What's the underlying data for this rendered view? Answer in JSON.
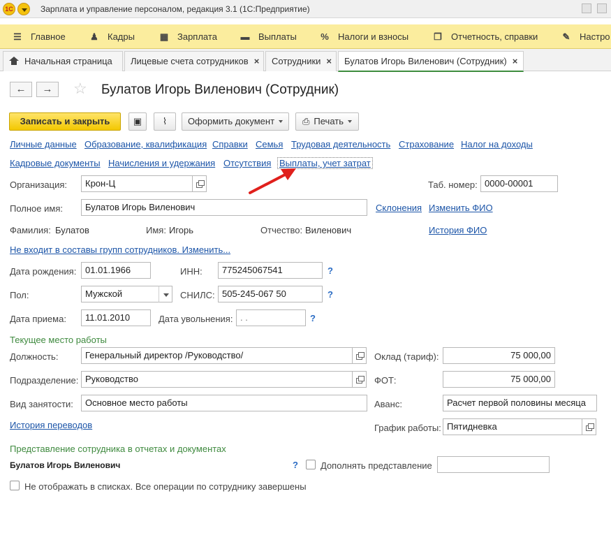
{
  "app": {
    "title": "Зарплата и управление персоналом, редакция 3.1  (1С:Предприятие)",
    "logo_text": "1С"
  },
  "sections": [
    {
      "icon": "☰",
      "label": "Главное"
    },
    {
      "icon": "♟",
      "label": "Кадры"
    },
    {
      "icon": "▦",
      "label": "Зарплата"
    },
    {
      "icon": "▬",
      "label": "Выплаты"
    },
    {
      "icon": "%",
      "label": "Налоги и взносы"
    },
    {
      "icon": "❐",
      "label": "Отчетность, справки"
    },
    {
      "icon": "✎",
      "label": "Настро"
    }
  ],
  "tabs": [
    {
      "label": "Начальная страница"
    },
    {
      "label": "Лицевые счета сотрудников",
      "close": "×"
    },
    {
      "label": "Сотрудники",
      "close": "×"
    },
    {
      "label": "Булатов Игорь Виленович (Сотрудник)",
      "close": "×"
    }
  ],
  "nav": {
    "back": "←",
    "forward": "→",
    "star": "☆"
  },
  "form": {
    "title": "Булатов Игорь Виленович (Сотрудник)"
  },
  "toolbar": {
    "save_close": "Записать и закрыть",
    "save_icon": "▣",
    "attach_icon": "⌇",
    "create_doc": "Оформить документ",
    "print_icon": "⎙",
    "print": "Печать"
  },
  "links_row1": [
    "Личные данные",
    "Образование, квалификация",
    "Справки",
    "Семья",
    "Трудовая деятельность",
    "Страхование",
    "Налог на доходы"
  ],
  "links_row2": [
    "Кадровые документы",
    "Начисления и удержания",
    "Отсутствия",
    "Выплаты, учет затрат"
  ],
  "fields": {
    "org_label": "Организация:",
    "org_value": "Крон-Ц",
    "tab_num_label": "Таб. номер:",
    "tab_num_value": "0000-00001",
    "fullname_label": "Полное имя:",
    "fullname_value": "Булатов Игорь Виленович",
    "declension_link": "Склонения",
    "change_fio_link": "Изменить ФИО",
    "surname_label": "Фамилия:",
    "surname_value": "Булатов",
    "name_label": "Имя:",
    "name_value": "Игорь",
    "patronymic_label": "Отчество:",
    "patronymic_value": "Виленович",
    "history_fio_link": "История ФИО",
    "groups_link": "Не входит в составы групп сотрудников. Изменить...",
    "birth_label": "Дата рождения:",
    "birth_value": "01.01.1966",
    "inn_label": "ИНН:",
    "inn_value": "775245067541",
    "gender_label": "Пол:",
    "gender_value": "Мужской",
    "snils_label": "СНИЛС:",
    "snils_value": "505-245-067 50",
    "hire_label": "Дата приема:",
    "hire_value": "11.01.2010",
    "fire_label": "Дата увольнения:",
    "fire_value": " .  .",
    "help": "?"
  },
  "workplace": {
    "title": "Текущее место работы",
    "position_label": "Должность:",
    "position_value": "Генеральный директор /Руководство/",
    "salary_label": "Оклад (тариф):",
    "salary_value": "75 000,00",
    "dept_label": "Подразделение:",
    "dept_value": "Руководство",
    "fot_label": "ФОТ:",
    "fot_value": "75 000,00",
    "employment_label": "Вид занятости:",
    "employment_value": "Основное место работы",
    "advance_label": "Аванс:",
    "advance_value": "Расчет первой половины месяца",
    "transfers_link": "История переводов",
    "schedule_label": "График работы:",
    "schedule_value": "Пятидневка"
  },
  "representation": {
    "title": "Представление сотрудника в отчетах и документах",
    "name": "Булатов Игорь Виленович",
    "supplement_label": "Дополнять представление",
    "supplement_value": "",
    "hide_label": "Не отображать в списках. Все операции по сотруднику завершены"
  },
  "colors": {
    "accent_yellow": "#f3c800",
    "link_blue": "#1c55a8",
    "group_green": "#3f8a3f",
    "arrow_red": "#e0201c"
  }
}
